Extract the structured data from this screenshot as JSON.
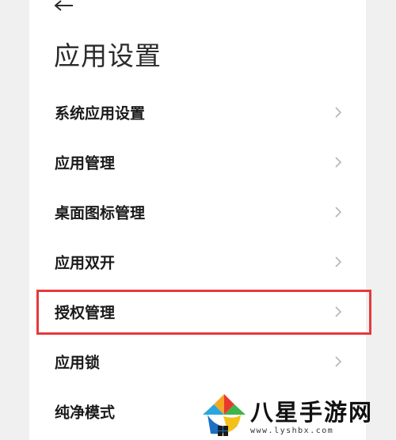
{
  "header": {
    "back_icon": "back-arrow-icon",
    "title": "应用设置"
  },
  "settings_list": [
    {
      "label": "系统应用设置"
    },
    {
      "label": "应用管理"
    },
    {
      "label": "桌面图标管理"
    },
    {
      "label": "应用双开"
    },
    {
      "label": "授权管理",
      "highlighted": true
    },
    {
      "label": "应用锁"
    },
    {
      "label": "纯净模式"
    }
  ],
  "highlight_color": "#e53a3a",
  "watermark": {
    "text": "八星手游网",
    "url": "www.lyshbx.com"
  }
}
